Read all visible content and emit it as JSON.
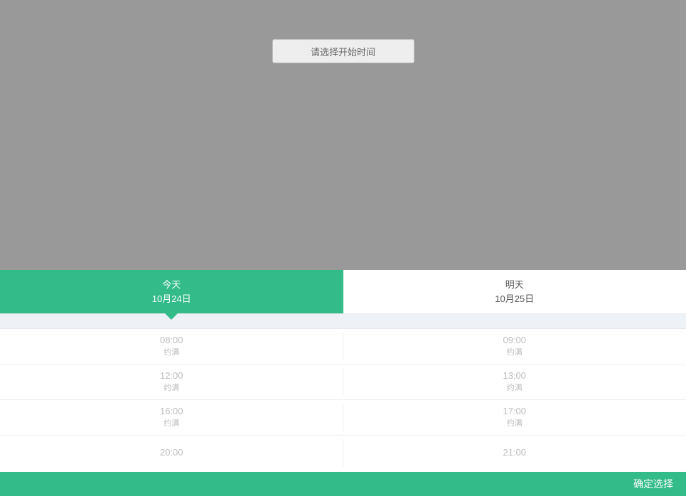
{
  "header": {
    "select_start_label": "请选择开始时间"
  },
  "tabs": [
    {
      "title": "今天",
      "date": "10月24日",
      "active": true
    },
    {
      "title": "明天",
      "date": "10月25日",
      "active": false
    }
  ],
  "time_slots": [
    [
      {
        "time": "08:00",
        "status": "约满"
      },
      {
        "time": "09:00",
        "status": "约满"
      }
    ],
    [
      {
        "time": "12:00",
        "status": "约满"
      },
      {
        "time": "13:00",
        "status": "约满"
      }
    ],
    [
      {
        "time": "16:00",
        "status": "约满"
      },
      {
        "time": "17:00",
        "status": "约满"
      }
    ],
    [
      {
        "time": "20:00",
        "status": ""
      },
      {
        "time": "21:00",
        "status": ""
      }
    ]
  ],
  "footer": {
    "confirm_label": "确定选择"
  }
}
